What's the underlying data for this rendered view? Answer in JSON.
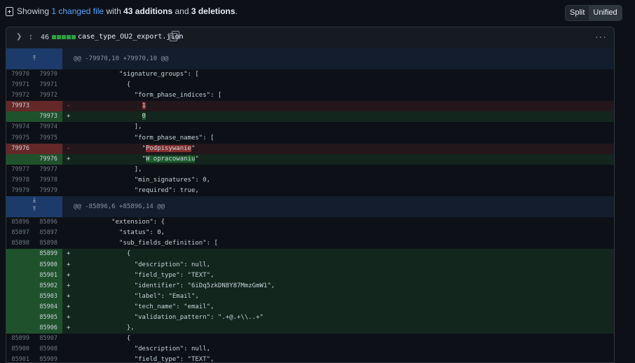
{
  "summary": {
    "prefix": "Showing ",
    "changed": "1 changed file",
    "mid1": " with ",
    "additions": "43 additions",
    "mid2": " and ",
    "deletions": "3 deletions",
    "suffix": "."
  },
  "view_toggle": {
    "split": "Split",
    "unified": "Unified",
    "active": "Unified"
  },
  "file": {
    "changes": "46",
    "name": "case_type_OU2_export.json",
    "more": "···"
  },
  "hunk1": {
    "header": "@@ -79970,10 +79970,10 @@",
    "lines": [
      {
        "type": "ctx",
        "old": "79970",
        "new": "79970",
        "code": "            \"signature_groups\": ["
      },
      {
        "type": "ctx",
        "old": "79971",
        "new": "79971",
        "code": "              {"
      },
      {
        "type": "ctx",
        "old": "79972",
        "new": "79972",
        "code": "                \"form_phase_indices\": ["
      },
      {
        "type": "del",
        "old": "79973",
        "new": "",
        "pre": "                  ",
        "hl": "1",
        "post": ""
      },
      {
        "type": "add",
        "old": "",
        "new": "79973",
        "pre": "                  ",
        "hl": "0",
        "post": ""
      },
      {
        "type": "ctx",
        "old": "79974",
        "new": "79974",
        "code": "                ],"
      },
      {
        "type": "ctx",
        "old": "79975",
        "new": "79975",
        "code": "                \"form_phase_names\": ["
      },
      {
        "type": "del",
        "old": "79976",
        "new": "",
        "pre": "                  \"",
        "hl": "Podpisywanie",
        "post": "\""
      },
      {
        "type": "add",
        "old": "",
        "new": "79976",
        "pre": "                  \"",
        "hl": "W opracowaniu",
        "post": "\""
      },
      {
        "type": "ctx",
        "old": "79977",
        "new": "79977",
        "code": "                ],"
      },
      {
        "type": "ctx",
        "old": "79978",
        "new": "79978",
        "code": "                \"min_signatures\": 0,"
      },
      {
        "type": "ctx",
        "old": "79979",
        "new": "79979",
        "code": "                \"required\": true,"
      }
    ]
  },
  "hunk2": {
    "header": "@@ -85896,6 +85896,14 @@",
    "lines": [
      {
        "type": "ctx",
        "old": "85896",
        "new": "85896",
        "code": "          \"extension\": {"
      },
      {
        "type": "ctx",
        "old": "85897",
        "new": "85897",
        "code": "            \"status\": 0,"
      },
      {
        "type": "ctx",
        "old": "85898",
        "new": "85898",
        "code": "            \"sub_fields_definition\": ["
      },
      {
        "type": "add",
        "old": "",
        "new": "85899",
        "code": "              {"
      },
      {
        "type": "add",
        "old": "",
        "new": "85900",
        "code": "                \"description\": null,"
      },
      {
        "type": "add",
        "old": "",
        "new": "85901",
        "code": "                \"field_type\": \"TEXT\","
      },
      {
        "type": "add",
        "old": "",
        "new": "85902",
        "code": "                \"identifier\": \"6iDq5zkDN8Y87MmzGmW1\","
      },
      {
        "type": "add",
        "old": "",
        "new": "85903",
        "code": "                \"label\": \"Email\","
      },
      {
        "type": "add",
        "old": "",
        "new": "85904",
        "code": "                \"tech_name\": \"email\","
      },
      {
        "type": "add",
        "old": "",
        "new": "85905",
        "code": "                \"validation_pattern\": \".+@.+\\\\..+\""
      },
      {
        "type": "add",
        "old": "",
        "new": "85906",
        "code": "              },"
      },
      {
        "type": "ctx",
        "old": "85899",
        "new": "85907",
        "code": "              {"
      },
      {
        "type": "ctx",
        "old": "85900",
        "new": "85908",
        "code": "                \"description\": null,"
      },
      {
        "type": "ctx",
        "old": "85901",
        "new": "85909",
        "code": "                \"field_type\": \"TEXT\","
      }
    ]
  }
}
